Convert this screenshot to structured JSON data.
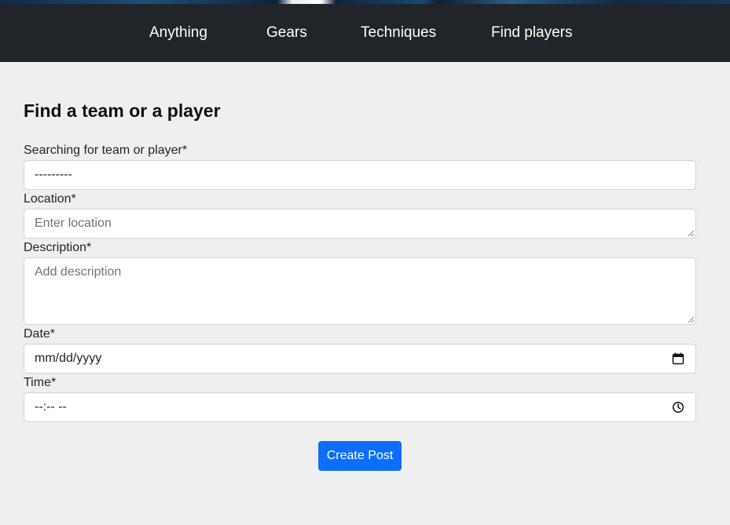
{
  "nav": {
    "items": [
      {
        "label": "Anything"
      },
      {
        "label": "Gears"
      },
      {
        "label": "Techniques"
      },
      {
        "label": "Find players"
      }
    ]
  },
  "form": {
    "title": "Find a team or a player",
    "search_type": {
      "label": "Searching for team or player*",
      "value": "---------"
    },
    "location": {
      "label": "Location*",
      "placeholder": "Enter location"
    },
    "description": {
      "label": "Description*",
      "placeholder": "Add description"
    },
    "date": {
      "label": "Date*",
      "value": "mm/dd/yyyy",
      "icon": "calendar-icon"
    },
    "time": {
      "label": "Time*",
      "value": "--:-- --",
      "icon": "clock-icon"
    },
    "submit_label": "Create Post"
  },
  "colors": {
    "navbar_bg": "#212529",
    "page_bg": "#efefef",
    "primary": "#0d6efd"
  }
}
